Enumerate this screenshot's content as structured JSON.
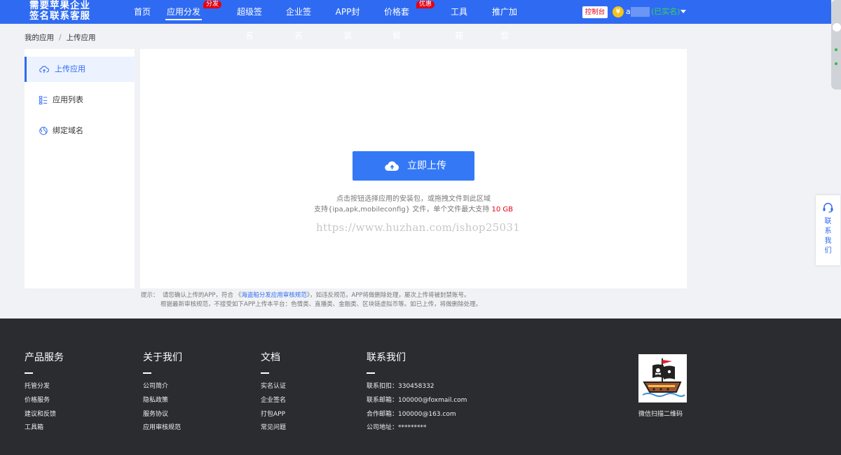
{
  "brand": {
    "logo_line1": "需要苹果企业",
    "logo_line2": "签名联系客服"
  },
  "nav": [
    {
      "label": "首页"
    },
    {
      "label": "应用分发",
      "badge": "分发",
      "active": true
    },
    {
      "label": "超级签名"
    },
    {
      "label": "企业签名"
    },
    {
      "label": "APP封装"
    },
    {
      "label": "价格套餐",
      "badge": "优惠"
    },
    {
      "label": "工具箱"
    },
    {
      "label": "推广加盟"
    }
  ],
  "user": {
    "console_label": "控制台",
    "coin_icon": "yen-coin-icon",
    "coin_symbol": "¥",
    "name_prefix": "a",
    "status": "(已实名)"
  },
  "breadcrumb": {
    "root": "我的应用",
    "separator": "/",
    "current": "上传应用"
  },
  "sidebar": {
    "items": [
      {
        "label": "上传应用",
        "icon": "cloud-upload-icon",
        "active": true
      },
      {
        "label": "应用列表",
        "icon": "list-icon"
      },
      {
        "label": "绑定域名",
        "icon": "globe-icon"
      }
    ]
  },
  "upload": {
    "button_label": "立即上传",
    "hint_line1": "点击按钮选择应用的安装包，或拖拽文件到此区域",
    "hint_line2_prefix": "支持{ipa,apk,mobileconfig} 文件，单个文件最大支持 ",
    "hint_line2_limit": "10 GB",
    "watermark": "https://www.huzhan.com/ishop25031"
  },
  "tips": {
    "label": "提示：",
    "line1_before": "请您确认上传的APP，符合 《",
    "line1_link": "海盗船分发应用审核规范",
    "line1_after": "》，如违反规范，APP将做删除处理，屡次上传将被封禁账号。",
    "line2": "根据最新审核规范，不接受如下APP上传本平台：色情类、直播类、金融类、区块链虚拟币等。如已上传，将做删除处理。"
  },
  "contact_float": {
    "label": "联系我们",
    "icon": "headset-icon"
  },
  "footer": {
    "columns": [
      {
        "title": "产品服务",
        "links": [
          "托管分发",
          "价格服务",
          "建议和反馈",
          "工具箱"
        ]
      },
      {
        "title": "关于我们",
        "links": [
          "公司简介",
          "隐私政策",
          "服务协议",
          "应用审核规范"
        ]
      },
      {
        "title": "文档",
        "links": [
          "实名认证",
          "企业签名",
          "打包APP",
          "常见问题"
        ]
      },
      {
        "title": "联系我们",
        "links": [
          "联系扣扣：330458332",
          "联系邮箱：100000@foxmail.com",
          "合作邮箱：100000@163.com",
          "公司地址：*********"
        ]
      }
    ],
    "qr_label": "微信扫描二维码",
    "qr_icon": "pirate-ship-icon"
  },
  "colors": {
    "brand_blue": "#2f6bf2",
    "button_blue": "#3478f6",
    "badge_red": "#e60012",
    "verified_green": "#39d353",
    "footer_bg": "#2b2c30"
  }
}
